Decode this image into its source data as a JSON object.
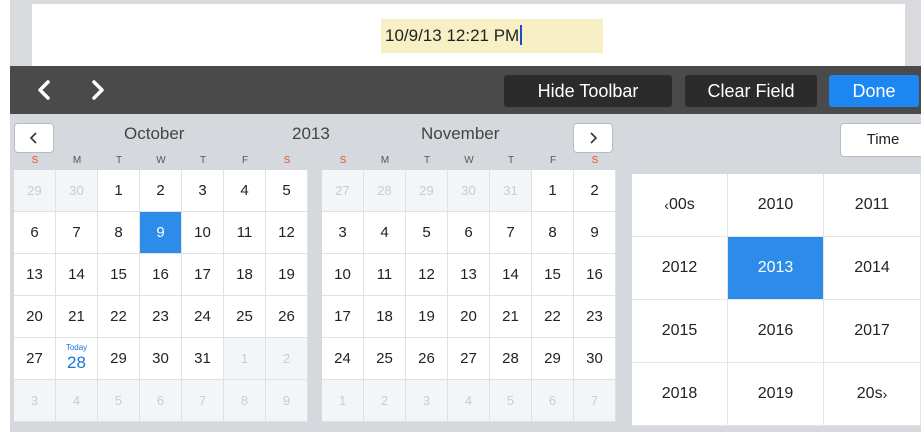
{
  "field": {
    "value": "10/9/13 12:21 PM"
  },
  "toolbar": {
    "hide_label": "Hide Toolbar",
    "clear_label": "Clear Field",
    "done_label": "Done"
  },
  "calendar": {
    "year": "2013",
    "time_label": "Time",
    "weekdays": [
      {
        "l": "S",
        "weekend": true
      },
      {
        "l": "M"
      },
      {
        "l": "T"
      },
      {
        "l": "W"
      },
      {
        "l": "T"
      },
      {
        "l": "F"
      },
      {
        "l": "S",
        "weekend": true
      }
    ],
    "months": [
      {
        "name": "October",
        "days": [
          {
            "d": "29",
            "dim": true
          },
          {
            "d": "30",
            "dim": true
          },
          {
            "d": "1"
          },
          {
            "d": "2"
          },
          {
            "d": "3"
          },
          {
            "d": "4"
          },
          {
            "d": "5"
          },
          {
            "d": "6"
          },
          {
            "d": "7"
          },
          {
            "d": "8"
          },
          {
            "d": "9",
            "selected": true
          },
          {
            "d": "10"
          },
          {
            "d": "11"
          },
          {
            "d": "12"
          },
          {
            "d": "13"
          },
          {
            "d": "14"
          },
          {
            "d": "15"
          },
          {
            "d": "16"
          },
          {
            "d": "17"
          },
          {
            "d": "18"
          },
          {
            "d": "19"
          },
          {
            "d": "20"
          },
          {
            "d": "21"
          },
          {
            "d": "22"
          },
          {
            "d": "23"
          },
          {
            "d": "24"
          },
          {
            "d": "25"
          },
          {
            "d": "26"
          },
          {
            "d": "27"
          },
          {
            "d": "28",
            "today": true
          },
          {
            "d": "29"
          },
          {
            "d": "30"
          },
          {
            "d": "31"
          },
          {
            "d": "1",
            "dim": true
          },
          {
            "d": "2",
            "dim": true
          },
          {
            "d": "3",
            "dim": true
          },
          {
            "d": "4",
            "dim": true
          },
          {
            "d": "5",
            "dim": true
          },
          {
            "d": "6",
            "dim": true
          },
          {
            "d": "7",
            "dim": true
          },
          {
            "d": "8",
            "dim": true
          },
          {
            "d": "9",
            "dim": true
          }
        ]
      },
      {
        "name": "November",
        "days": [
          {
            "d": "27",
            "dim": true
          },
          {
            "d": "28",
            "dim": true
          },
          {
            "d": "29",
            "dim": true
          },
          {
            "d": "30",
            "dim": true
          },
          {
            "d": "31",
            "dim": true
          },
          {
            "d": "1"
          },
          {
            "d": "2"
          },
          {
            "d": "3"
          },
          {
            "d": "4"
          },
          {
            "d": "5"
          },
          {
            "d": "6"
          },
          {
            "d": "7"
          },
          {
            "d": "8"
          },
          {
            "d": "9"
          },
          {
            "d": "10"
          },
          {
            "d": "11"
          },
          {
            "d": "12"
          },
          {
            "d": "13"
          },
          {
            "d": "14"
          },
          {
            "d": "15"
          },
          {
            "d": "16"
          },
          {
            "d": "17"
          },
          {
            "d": "18"
          },
          {
            "d": "19"
          },
          {
            "d": "20"
          },
          {
            "d": "21"
          },
          {
            "d": "22"
          },
          {
            "d": "23"
          },
          {
            "d": "24"
          },
          {
            "d": "25"
          },
          {
            "d": "26"
          },
          {
            "d": "27"
          },
          {
            "d": "28"
          },
          {
            "d": "29"
          },
          {
            "d": "30"
          },
          {
            "d": "1",
            "dim": true
          },
          {
            "d": "2",
            "dim": true
          },
          {
            "d": "3",
            "dim": true
          },
          {
            "d": "4",
            "dim": true
          },
          {
            "d": "5",
            "dim": true
          },
          {
            "d": "6",
            "dim": true
          },
          {
            "d": "7",
            "dim": true
          }
        ]
      }
    ],
    "today_label": "Today",
    "years": [
      {
        "label": "00s",
        "chev": "left"
      },
      {
        "label": "2010"
      },
      {
        "label": "2011"
      },
      {
        "label": "2012"
      },
      {
        "label": "2013",
        "selected": true
      },
      {
        "label": "2014"
      },
      {
        "label": "2015"
      },
      {
        "label": "2016"
      },
      {
        "label": "2017"
      },
      {
        "label": "2018"
      },
      {
        "label": "2019"
      },
      {
        "label": "20s",
        "chev": "right"
      }
    ]
  },
  "colors": {
    "accent": "#2d8cea",
    "done": "#1c86f2",
    "toolbar": "#4a4a4a",
    "weekend": "#e0522a",
    "field_bg": "#f6f0c4"
  },
  "icons": [
    "chevron-left-icon",
    "chevron-right-icon"
  ]
}
